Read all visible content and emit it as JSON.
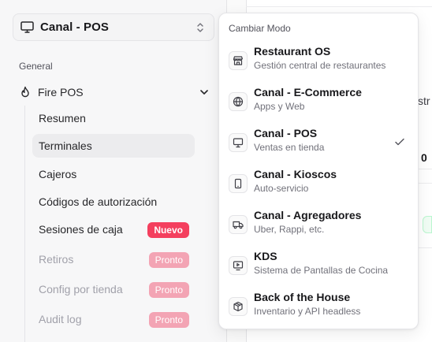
{
  "switcher": {
    "label": "Canal - POS",
    "icon": "monitor-icon"
  },
  "sidebar": {
    "section_label": "General",
    "group": {
      "label": "Fire POS",
      "icon": "flame-icon"
    },
    "items": [
      {
        "label": "Resumen"
      },
      {
        "label": "Terminales",
        "active": true
      },
      {
        "label": "Cajeros"
      },
      {
        "label": "Códigos de autorización"
      },
      {
        "label": "Sesiones de caja",
        "badge": "Nuevo"
      },
      {
        "label": "Retiros",
        "badge": "Pronto",
        "disabled": true
      },
      {
        "label": "Config por tienda",
        "badge": "Pronto",
        "disabled": true
      },
      {
        "label": "Audit log",
        "badge": "Pronto",
        "disabled": true
      }
    ]
  },
  "main": {
    "fragments": [
      "str",
      "0"
    ]
  },
  "dropdown": {
    "title": "Cambiar Modo",
    "options": [
      {
        "title": "Restaurant OS",
        "subtitle": "Gestión central de restaurantes",
        "icon": "store-icon"
      },
      {
        "title": "Canal - E-Commerce",
        "subtitle": "Apps y Web",
        "icon": "globe-icon"
      },
      {
        "title": "Canal - POS",
        "subtitle": "Ventas en tienda",
        "icon": "monitor-icon",
        "selected": true
      },
      {
        "title": "Canal - Kioscos",
        "subtitle": "Auto-servicio",
        "icon": "tablet-icon"
      },
      {
        "title": "Canal - Agregadores",
        "subtitle": "Uber, Rappi, etc.",
        "icon": "truck-icon"
      },
      {
        "title": "KDS",
        "subtitle": "Sistema de Pantallas de Cocina",
        "icon": "kds-screen-icon"
      },
      {
        "title": "Back of the House",
        "subtitle": "Inventario y API headless",
        "icon": "box-icon"
      }
    ]
  },
  "colors": {
    "badge_new": "#f43f5e",
    "badge_soon": "#f3a4b4",
    "active_bg": "#ececee"
  }
}
